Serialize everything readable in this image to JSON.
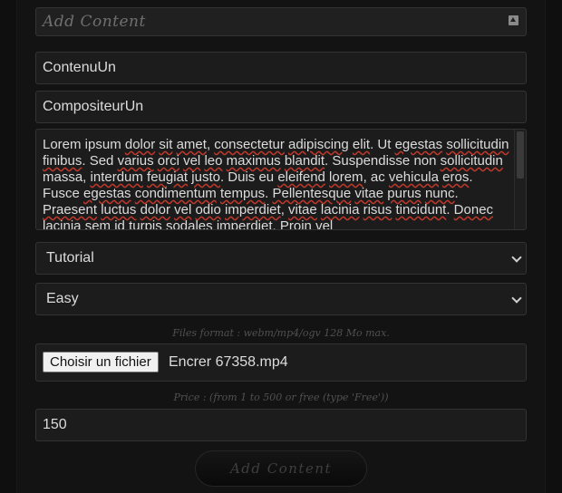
{
  "form": {
    "header_title": "Add Content",
    "content_name": "ContenuUn",
    "composer_name": "CompositeurUn",
    "description_segments": [
      {
        "t": "Lorem ipsum ",
        "s": false
      },
      {
        "t": "dolor",
        "s": true
      },
      {
        "t": " ",
        "s": false
      },
      {
        "t": "sit",
        "s": true
      },
      {
        "t": " ",
        "s": false
      },
      {
        "t": "amet",
        "s": true
      },
      {
        "t": ", ",
        "s": false
      },
      {
        "t": "consectetur",
        "s": true
      },
      {
        "t": " ",
        "s": false
      },
      {
        "t": "adipiscing",
        "s": true
      },
      {
        "t": " ",
        "s": false
      },
      {
        "t": "elit",
        "s": true
      },
      {
        "t": ". Ut ",
        "s": false
      },
      {
        "t": "egestas",
        "s": true
      },
      {
        "t": " ",
        "s": false
      },
      {
        "t": "sollicitudin",
        "s": true
      },
      {
        "t": " ",
        "s": false
      },
      {
        "t": "finibus",
        "s": true
      },
      {
        "t": ". Sed ",
        "s": false
      },
      {
        "t": "varius",
        "s": true
      },
      {
        "t": " ",
        "s": false
      },
      {
        "t": "orci",
        "s": true
      },
      {
        "t": " ",
        "s": false
      },
      {
        "t": "vel",
        "s": true
      },
      {
        "t": " ",
        "s": false
      },
      {
        "t": "leo",
        "s": true
      },
      {
        "t": " ",
        "s": false
      },
      {
        "t": "maximus",
        "s": true
      },
      {
        "t": " ",
        "s": false
      },
      {
        "t": "blandit",
        "s": true
      },
      {
        "t": ". Suspendisse non ",
        "s": false
      },
      {
        "t": "sollicitudin",
        "s": true
      },
      {
        "t": " massa, ",
        "s": false
      },
      {
        "t": "interdum",
        "s": true
      },
      {
        "t": " ",
        "s": false
      },
      {
        "t": "feugiat",
        "s": true
      },
      {
        "t": " ",
        "s": false
      },
      {
        "t": "justo",
        "s": true
      },
      {
        "t": ". Duis eu ",
        "s": false
      },
      {
        "t": "eleifend",
        "s": true
      },
      {
        "t": " ",
        "s": false
      },
      {
        "t": "lorem",
        "s": true
      },
      {
        "t": ", ac ",
        "s": false
      },
      {
        "t": "vehicula",
        "s": true
      },
      {
        "t": " ",
        "s": false
      },
      {
        "t": "eros",
        "s": true
      },
      {
        "t": ". Fusce ",
        "s": false
      },
      {
        "t": "egestas",
        "s": true
      },
      {
        "t": " ",
        "s": false
      },
      {
        "t": "condimentum",
        "s": true
      },
      {
        "t": " ",
        "s": false
      },
      {
        "t": "tempus",
        "s": true
      },
      {
        "t": ". ",
        "s": false
      },
      {
        "t": "Pellentesque",
        "s": true
      },
      {
        "t": " ",
        "s": false
      },
      {
        "t": "vitae",
        "s": true
      },
      {
        "t": " ",
        "s": false
      },
      {
        "t": "purus",
        "s": true
      },
      {
        "t": " ",
        "s": false
      },
      {
        "t": "nunc",
        "s": true
      },
      {
        "t": ". ",
        "s": false
      },
      {
        "t": "Praesent",
        "s": true
      },
      {
        "t": " ",
        "s": false
      },
      {
        "t": "luctus",
        "s": true
      },
      {
        "t": " ",
        "s": false
      },
      {
        "t": "dolor",
        "s": true
      },
      {
        "t": " ",
        "s": false
      },
      {
        "t": "vel",
        "s": true
      },
      {
        "t": " ",
        "s": false
      },
      {
        "t": "odio",
        "s": true
      },
      {
        "t": " ",
        "s": false
      },
      {
        "t": "imperdiet",
        "s": true
      },
      {
        "t": ", ",
        "s": false
      },
      {
        "t": "vitae",
        "s": true
      },
      {
        "t": " ",
        "s": false
      },
      {
        "t": "lacinia",
        "s": true
      },
      {
        "t": " ",
        "s": false
      },
      {
        "t": "risus",
        "s": true
      },
      {
        "t": " ",
        "s": false
      },
      {
        "t": "tincidunt",
        "s": true
      },
      {
        "t": ". ",
        "s": false
      },
      {
        "t": "Donec",
        "s": true
      },
      {
        "t": " ",
        "s": false
      },
      {
        "t": "lacinia",
        "s": true
      },
      {
        "t": " ",
        "s": false
      },
      {
        "t": "sem",
        "s": true
      },
      {
        "t": " ",
        "s": false
      },
      {
        "t": "id",
        "s": true
      },
      {
        "t": " ",
        "s": false
      },
      {
        "t": "turpis",
        "s": true
      },
      {
        "t": " ",
        "s": false
      },
      {
        "t": "sodales",
        "s": true
      },
      {
        "t": " ",
        "s": false
      },
      {
        "t": "imperdiet",
        "s": true
      },
      {
        "t": ". ",
        "s": false
      },
      {
        "t": "Proin",
        "s": true
      },
      {
        "t": " ",
        "s": false
      },
      {
        "t": "vel",
        "s": true
      }
    ],
    "category_selected": "Tutorial",
    "difficulty_selected": "Easy",
    "file_format_hint": "Files format : webm/mp4/ogv 128 Mo max.",
    "file_button_label": "Choisir un fichier",
    "file_name": "Encrer 67358.mp4",
    "price_hint": "Price : (from 1 to 500 or free (type 'Free'))",
    "price_value": "150",
    "submit_label": "Add Content"
  },
  "colors": {
    "background": "#0f0f0f",
    "field_bg": "#1c1c1c",
    "text": "#dcdcdc",
    "hint_text": "#505050",
    "spellcheck_underline": "#c0392b"
  },
  "icons": {
    "header": "collapse-up-icon",
    "select": "chevron-down-icon"
  }
}
